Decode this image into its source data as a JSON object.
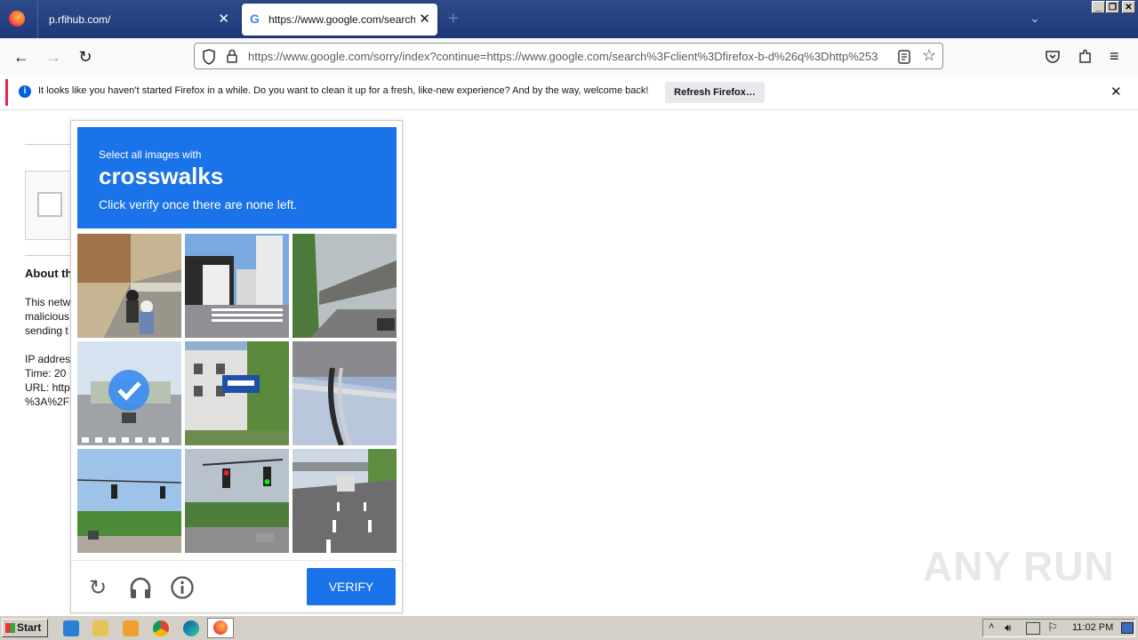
{
  "browser": {
    "tabs": [
      {
        "label": "p.rfihub.com/",
        "close": "✕"
      },
      {
        "label": "https://www.google.com/search?c",
        "close": "✕"
      }
    ],
    "new_tab": "+",
    "url": "https://www.google.com/sorry/index?continue=https://www.google.com/search%3Fclient%3Dfirefox-b-d%26q%3Dhttp%253",
    "url_domain": "google.com"
  },
  "notification": {
    "message": "It looks like you haven’t started Firefox in a while. Do you want to clean it up for a fresh, like-new experience? And by the way, welcome back!",
    "button": "Refresh Firefox…",
    "close": "✕"
  },
  "page": {
    "about_heading": "About th",
    "lines": [
      "This netw",
      "malicious",
      "sending t",
      "",
      "IP addres",
      "Time: 20",
      "URL: http",
      "%3A%2F"
    ]
  },
  "captcha": {
    "select_text": "Select all images with",
    "object": "crosswalks",
    "hint": "Click verify once there are none left.",
    "verify_label": "VERIFY",
    "tiles_selected": [
      false,
      false,
      false,
      true,
      false,
      false,
      false,
      false,
      false
    ]
  },
  "watermark": "ANY RUN",
  "taskbar": {
    "start_label": "Start",
    "clock": "11:02 PM"
  },
  "colors": {
    "captcha_blue": "#1a73e8",
    "tabbar": "#2d4a8a"
  }
}
